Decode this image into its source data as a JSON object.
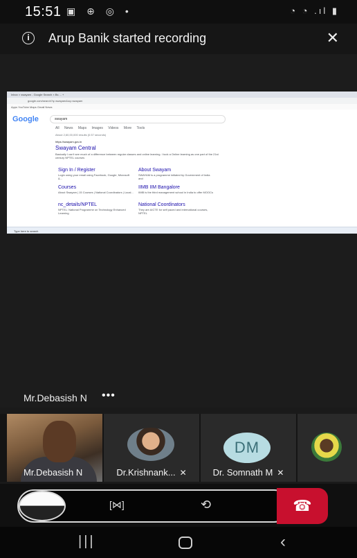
{
  "status_bar": {
    "time": "15:51",
    "left_icons": "▣ ⊕ ◎ •",
    "right_icons": "◔ ◔ .ıl ▮"
  },
  "recording_banner": {
    "info_icon": "i",
    "text": "Arup Banik started recording",
    "close": "✕"
  },
  "shared_screen": {
    "tabs": "Inbox  ×   swayam - Google Search  ×   Bs   ...   +",
    "url": "google.com/search?q=swayam&oq=swayam",
    "bookmarks": "Apps   YouTube   Maps   Gmail   News",
    "logo": "Google",
    "query": "swayam",
    "search_tabs": "All   News   Maps   Images   Videos   More   Tools",
    "result_count": "About 2,60,00,000 results (0.57 seconds)",
    "result_url": "https://swayam.gov.in",
    "result_title": "Swayam Central",
    "result_snippet": "Basically I can't see much of a difference between regular classes and online learning. I took a Online learning as one part of the 21st century NPTEL courses",
    "sitelinks": [
      {
        "title": "Sign In / Register",
        "desc": "Login using your email using Facebook, Google, Microsoft &..."
      },
      {
        "title": "About Swayam",
        "desc": "SWAYAM is a programme initiated by Government of India and"
      },
      {
        "title": "Courses",
        "desc": "About Swayam | 15 Courses | National Coordinators | Local..."
      },
      {
        "title": "IIMB IIM Bangalore",
        "desc": "IIMB is the third management school in India to offer MOOCs"
      },
      {
        "title": "nc_details/NPTEL",
        "desc": "NPTEL: National Programme on Technology Enhanced Learning"
      },
      {
        "title": "National Coordinators",
        "desc": "They are AICTE for self paced and international courses, NPTEL"
      }
    ],
    "taskbar": "Type here to search"
  },
  "presenter": {
    "name": "Mr.Debasish N",
    "more": "•••"
  },
  "participants": [
    {
      "name": "Mr.Debasish N"
    },
    {
      "name": "Dr.Krishnank...",
      "muted": "✕"
    },
    {
      "name": "Dr. Somnath M",
      "initials": "DM",
      "muted": "✕"
    },
    {
      "name": ""
    }
  ],
  "controls": {
    "frame_icon": "[⋈]",
    "switch_camera_icon": "⟲",
    "end_call_icon": "☎"
  },
  "nav": {
    "recents": "|||",
    "back": "‹"
  },
  "colors": {
    "end_call": "#c8102e",
    "avatar_dm_bg": "#b7dce2"
  }
}
